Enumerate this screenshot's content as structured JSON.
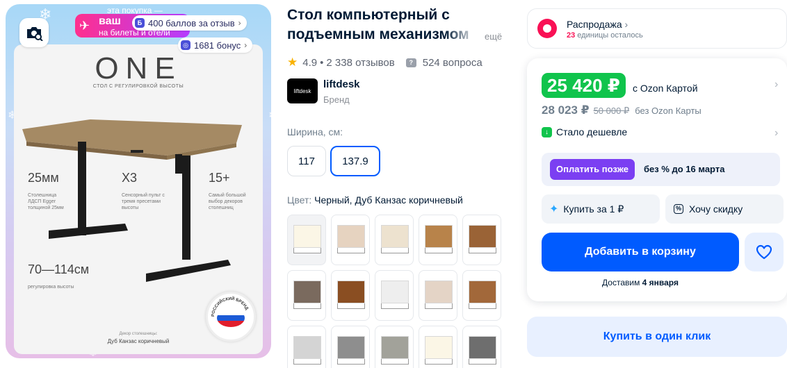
{
  "gallery": {
    "promo": {
      "top_text": "эта покупка —",
      "line1": "ваш",
      "line2": "на билеты и отели",
      "points_chip": "400 баллов за отзыв",
      "points_badge": "Б",
      "bonus_chip": "1681 бонус",
      "bonus_badge": "◎"
    },
    "image": {
      "brand": "ONE",
      "brand_sub": "СТОЛ С РЕГУЛИРОВКОЙ ВЫСОТЫ",
      "specs": [
        {
          "big": "25мм",
          "small": "Столешница ЛДСП Egger толщиной 25мм"
        },
        {
          "big": "X3",
          "small": "Сенсорный пульт с тремя пресетами высоты"
        },
        {
          "big": "15+",
          "small": "Самый большой выбор декоров столешниц"
        },
        {
          "big": "70—114см",
          "small": "регулировка высоты"
        }
      ],
      "decor_caption": "Декор столешницы:",
      "decor_name": "Дуб Канзас коричневый",
      "badge_text": "РОССИЙСКИЙ БРЕНД"
    }
  },
  "product": {
    "title": "Стол компьютерный с подъемным механизмом",
    "more": "ещё",
    "rating": "4.9",
    "reviews": "2 338 отзывов",
    "questions": "524 вопроса",
    "brand_logo": "liftdesk",
    "brand_name": "liftdesk",
    "brand_label": "Бренд",
    "width_label": "Ширина, см:",
    "width_options": [
      "117",
      "137.9"
    ],
    "color_label": "Цвет: ",
    "color_value": "Черный, Дуб Канзас коричневый",
    "swatch_colors": [
      "#fbf6e6",
      "#e6d3c0",
      "#ede2cf",
      "#b8834a",
      "#9a6336",
      "#7a6a5e",
      "#8a4e22",
      "#eeeeee",
      "#e4d4c6",
      "#a2683a",
      "#d4d4d4",
      "#8e8e8e",
      "#a2a29a",
      "#fbf6e6",
      "#6e6e6e"
    ]
  },
  "buybox": {
    "sale_title": "Распродажа",
    "sale_count": "23",
    "sale_rest": " единицы осталось",
    "price_card": "25 420 ₽",
    "price_card_label": "с Ozon Картой",
    "price_base": "28 023 ₽",
    "price_old": "50 000 ₽",
    "price_nocard": "без Ozon Карты",
    "cheaper": "Стало дешевле",
    "pay_later_btn": "Оплатить позже",
    "pay_later_text": "без % до 16 марта",
    "buy_for_one": "Купить за 1 ₽",
    "want_discount": "Хочу скидку",
    "add_to_cart": "Добавить в корзину",
    "delivery_prefix": "Доставим ",
    "delivery_date": "4 января",
    "one_click": "Купить в один клик"
  },
  "colors": {
    "accent": "#005bff",
    "green_price": "#10c44c",
    "sale_pink": "#f91155",
    "pay_later_purple": "#7b3ff2"
  }
}
